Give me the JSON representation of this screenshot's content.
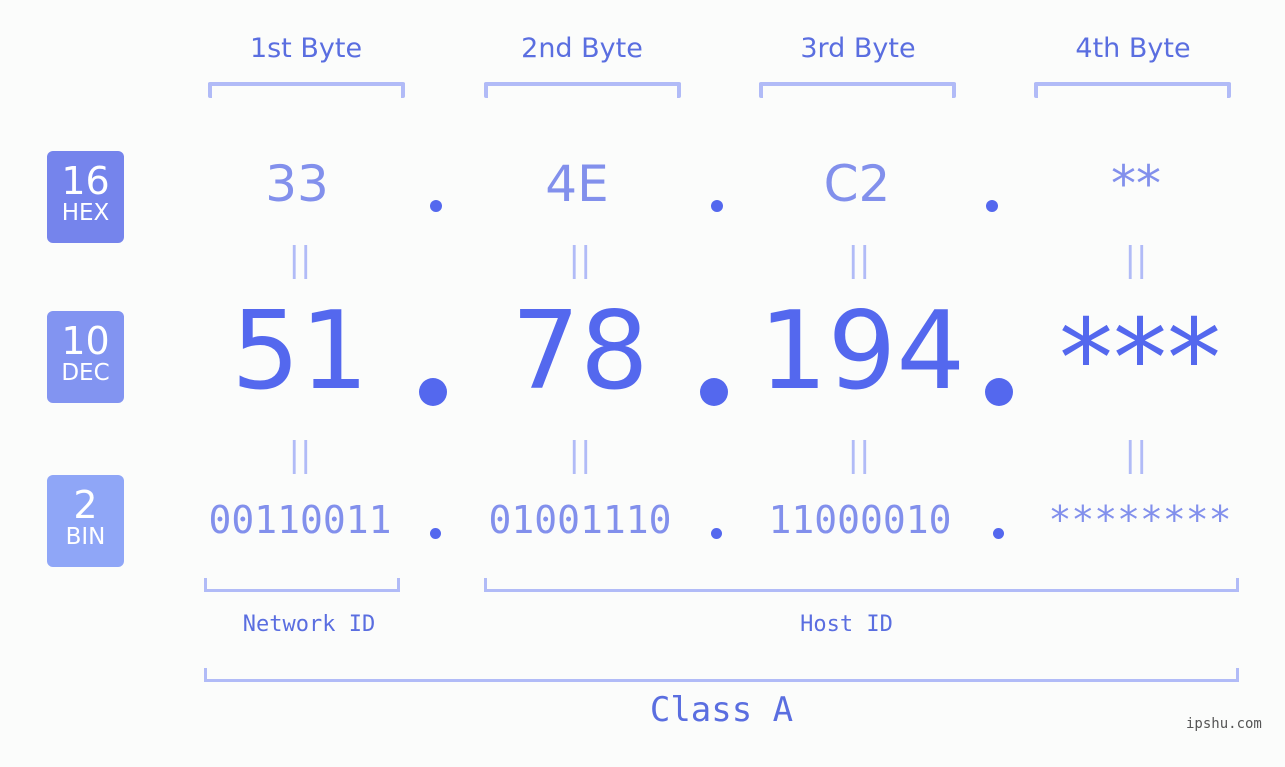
{
  "headers": [
    "1st Byte",
    "2nd Byte",
    "3rd Byte",
    "4th Byte"
  ],
  "badges": {
    "hex": {
      "num": "16",
      "label": "HEX",
      "color": "#7584ec"
    },
    "dec": {
      "num": "10",
      "label": "DEC",
      "color": "#8294f1"
    },
    "bin": {
      "num": "2",
      "label": "BIN",
      "color": "#8fa6f7"
    }
  },
  "hex": [
    "33",
    "4E",
    "C2",
    "**"
  ],
  "dec": [
    "51",
    "78",
    "194",
    "***"
  ],
  "bin": [
    "00110011",
    "01001110",
    "11000010",
    "********"
  ],
  "equals_sign": "||",
  "network_id_label": "Network ID",
  "host_id_label": "Host ID",
  "class_label": "Class A",
  "watermark": "ipshu.com",
  "colors": {
    "primary": "#5468ee",
    "light": "#8290ec",
    "bracket": "#b1bbf7",
    "background": "#fbfcfb"
  }
}
